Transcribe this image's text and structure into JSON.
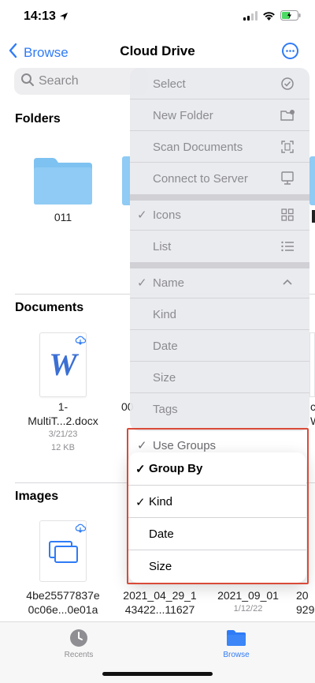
{
  "status": {
    "time": "14:13"
  },
  "nav": {
    "back_label": "Browse",
    "title": "Cloud Drive"
  },
  "search": {
    "placeholder": "Search"
  },
  "sections": {
    "folders": "Folders",
    "documents": "Documents",
    "images": "Images"
  },
  "folders": [
    {
      "name": "011"
    }
  ],
  "documents": [
    {
      "name_line1": "1-",
      "name_line2": "MultiT...2.docx",
      "date": "3/21/23",
      "size": "12 KB",
      "letter": "W"
    },
    {
      "name_line1": "00"
    },
    {
      "name_line1": "c",
      "name_line2": "W"
    }
  ],
  "images": [
    {
      "name_line1": "4be25577837e",
      "name_line2": "0c06e...0e01a"
    },
    {
      "name_line1": "2021_04_29_1",
      "name_line2": "43422...11627"
    },
    {
      "name_line1": "2021_09_01",
      "date": "1/12/22"
    },
    {
      "name_line1": "20",
      "name_line2": "929"
    }
  ],
  "menu": {
    "select": "Select",
    "new_folder": "New Folder",
    "scan_documents": "Scan Documents",
    "connect_to_server": "Connect to Server",
    "icons": "Icons",
    "list": "List",
    "name": "Name",
    "kind": "Kind",
    "date": "Date",
    "size": "Size",
    "tags": "Tags",
    "use_groups": "Use Groups",
    "check": "✓"
  },
  "submenu": {
    "group_by": "Group By",
    "kind": "Kind",
    "date": "Date",
    "size": "Size",
    "check": "✓"
  },
  "tabbar": {
    "recents": "Recents",
    "browse": "Browse"
  },
  "colors": {
    "accent": "#2f7bf6",
    "folder": "#7ec2f1",
    "highlight": "#d94a38"
  }
}
